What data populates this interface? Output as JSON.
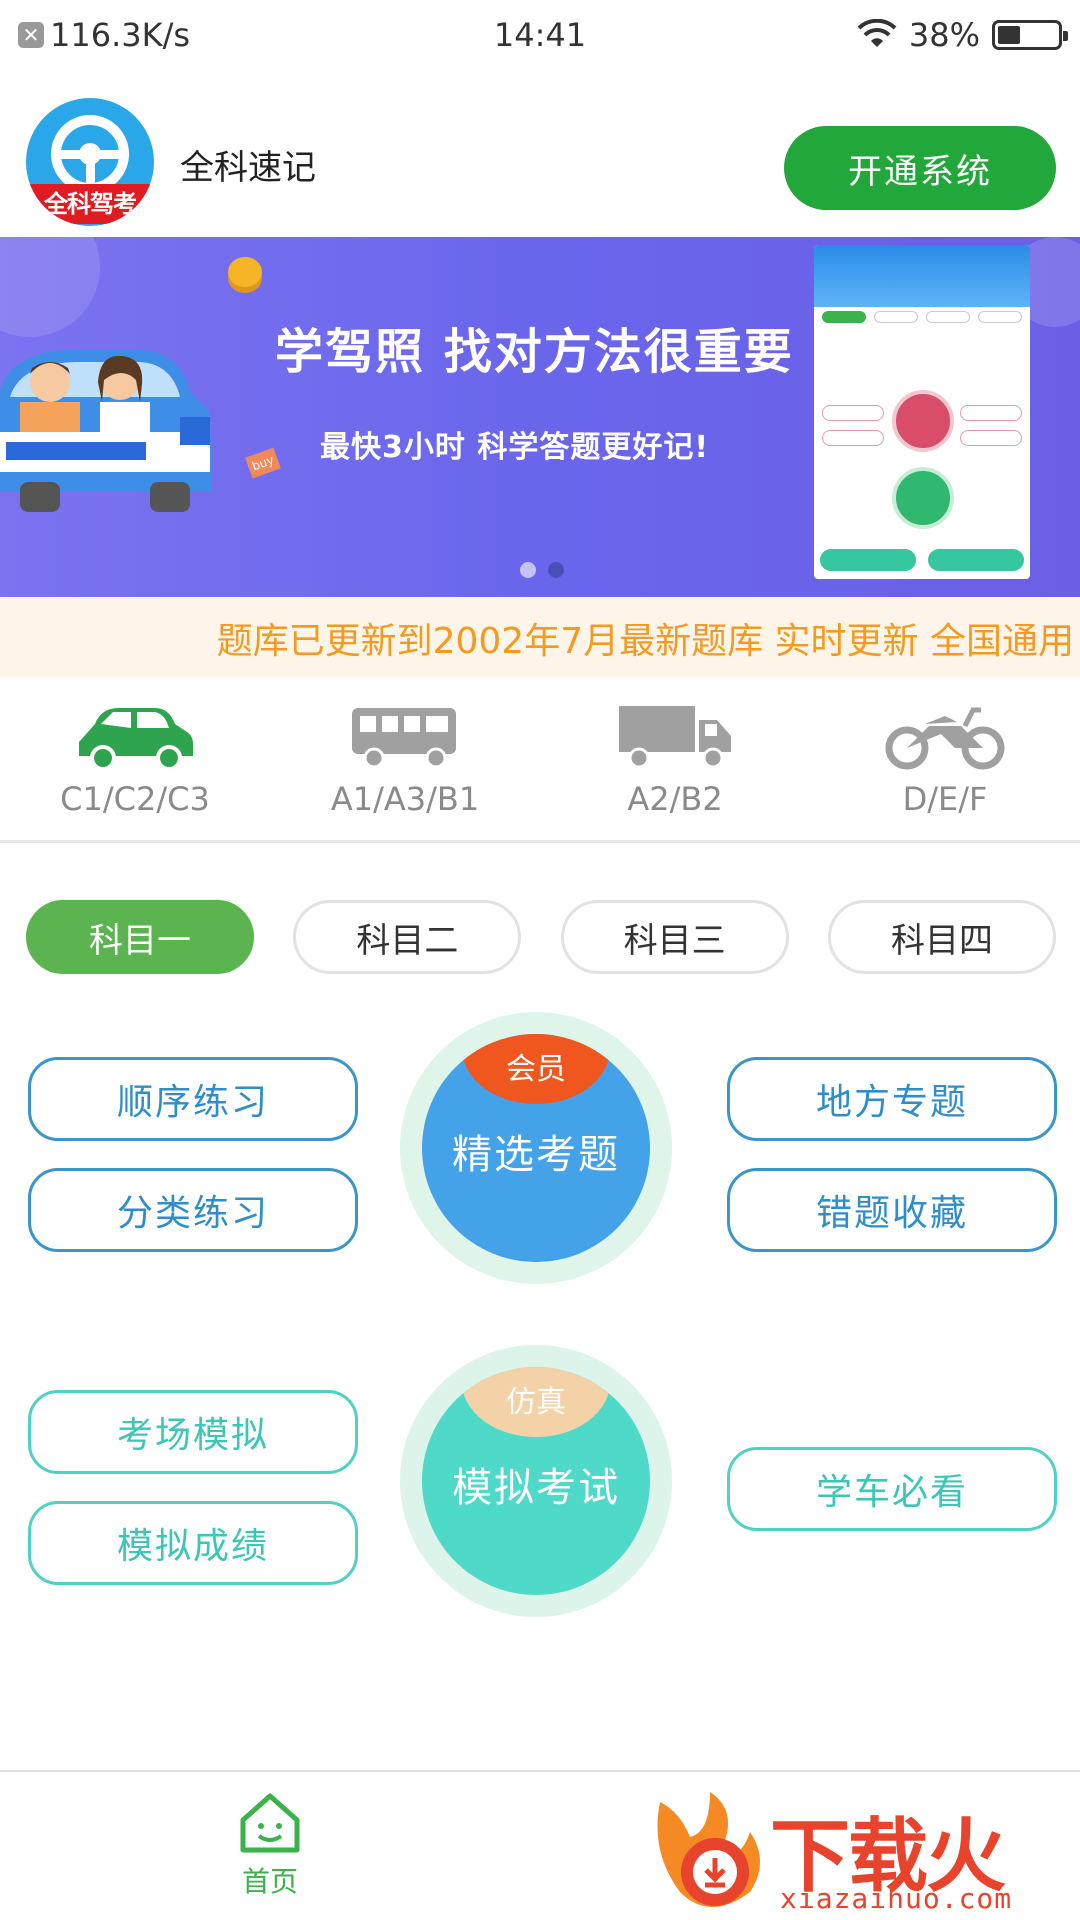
{
  "status": {
    "network_speed": "116.3K/s",
    "time": "14:41",
    "battery": "38%",
    "battery_level": 0.38
  },
  "header": {
    "logo_text": "全科驾考",
    "app_name": "全科速记",
    "open_button": "开通系统"
  },
  "banner": {
    "title": "学驾照  找对方法很重要",
    "subtitle": "最快3小时    科学答题更好记!",
    "sign_text": "buy",
    "page_count": 2,
    "active_page": 1
  },
  "notice": {
    "text": "题库已更新到2002年7月最新题库 实时更新 全国通用"
  },
  "vehicles": [
    {
      "label": "C1/C2/C3",
      "icon": "car-icon",
      "color": "#2ea44f"
    },
    {
      "label": "A1/A3/B1",
      "icon": "bus-icon",
      "color": "#a0a0a0"
    },
    {
      "label": "A2/B2",
      "icon": "truck-icon",
      "color": "#a0a0a0"
    },
    {
      "label": "D/E/F",
      "icon": "motorcycle-icon",
      "color": "#a0a0a0"
    }
  ],
  "subjects": [
    "科目一",
    "科目二",
    "科目三",
    "科目四"
  ],
  "practice": {
    "sequential": "顺序练习",
    "category": "分类练习",
    "local_topics": "地方专题",
    "mistakes": "错题收藏",
    "featured_badge": "会员",
    "featured": "精选考题"
  },
  "exam": {
    "venue_sim": "考场模拟",
    "sim_scores": "模拟成绩",
    "must_watch": "学车必看",
    "sim_badge": "仿真",
    "sim_exam": "模拟考试"
  },
  "bottom_nav": {
    "home": "首页"
  },
  "watermark": {
    "text": "下载火",
    "url": "xiazaihuo.com"
  },
  "colors": {
    "primary_green": "#22a83a",
    "subject_active": "#5bb450",
    "blue_button": "#2e8ec9",
    "teal_button": "#3cc6b6",
    "featured_circle": "#44a3e8",
    "sim_circle": "#4fd9c8",
    "member_badge": "#f0571e",
    "sim_badge": "#f2d2a6",
    "notice_text": "#f39a1f"
  }
}
